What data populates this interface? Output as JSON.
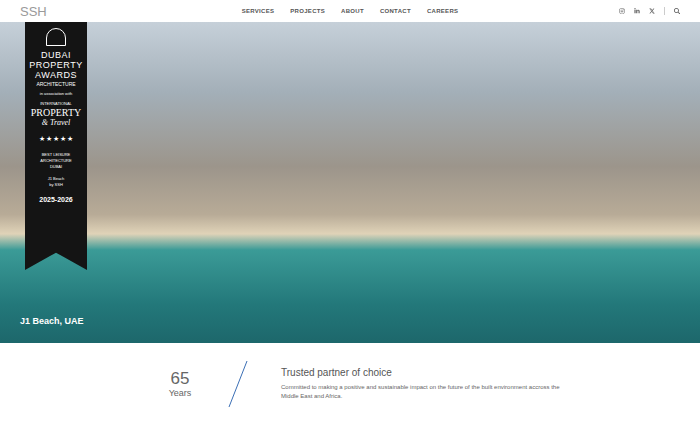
{
  "nav": {
    "logo": "SSH",
    "links": [
      {
        "label": "SERVICES",
        "selected": false
      },
      {
        "label": "PROJECTS",
        "selected": false
      },
      {
        "label": "ABOUT",
        "selected": false
      },
      {
        "label": "CONTACT",
        "selected": false
      },
      {
        "label": "CAREERS",
        "selected": false
      }
    ]
  },
  "hero": {
    "caption": "J1 Beach, UAE",
    "badge": {
      "title_lines": [
        "DUBAI",
        "PROPERTY",
        "AWARDS"
      ],
      "category": "ARCHITECTURE",
      "association": "in association with",
      "partner_top": "INTERNATIONAL",
      "partner_main": "PROPERTY",
      "partner_sub": "& Travel",
      "star_glyph": "★",
      "stars": 5,
      "award_lines": [
        "BEST LEISURE",
        "ARCHITECTURE",
        "DUBAI"
      ],
      "project_lines": [
        "J1 Beach",
        "by SSH"
      ],
      "year": "2025-2026"
    }
  },
  "stats": {
    "value": "65",
    "unit": "Years",
    "headline": "Trusted partner of choice",
    "description": "Committed to making a positive and sustainable impact on the future of the built environment accross the Middle East and Africa."
  }
}
